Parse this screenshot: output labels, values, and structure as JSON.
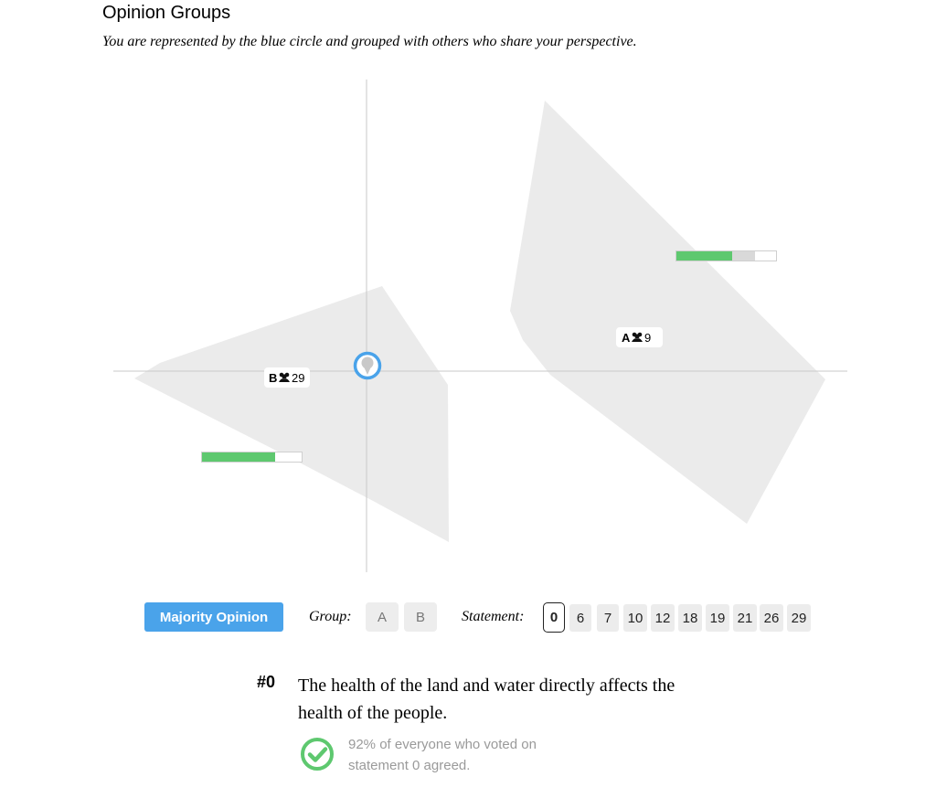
{
  "header": {
    "title": "Opinion Groups",
    "subtitle": "You are represented by the blue circle and grouped with others who share your perspective."
  },
  "groups": [
    {
      "id": "A",
      "count": "9",
      "agree_fraction": 0.56,
      "disagree_fraction": 0.23
    },
    {
      "id": "B",
      "count": "29",
      "agree_fraction": 0.73,
      "disagree_fraction": 0.0
    }
  ],
  "controls": {
    "majority_label": "Majority Opinion",
    "group_label": "Group:",
    "group_options": [
      "A",
      "B"
    ],
    "statement_label": "Statement:",
    "statement_options": [
      "0",
      "6",
      "7",
      "10",
      "12",
      "18",
      "19",
      "21",
      "26",
      "29"
    ],
    "selected_statement": "0"
  },
  "statement": {
    "number": "#0",
    "text": "The health of the land and water directly affects the health of the people.",
    "summary_line1": "92% of everyone who voted on",
    "summary_line2": "statement 0 agreed."
  },
  "colors": {
    "accent_blue": "#4aa3ea",
    "agree_green": "#5ec86f",
    "hull_gray": "#ebebeb",
    "axis_gray": "#c8c8c8",
    "disagree_gray": "#d9d9d9"
  }
}
